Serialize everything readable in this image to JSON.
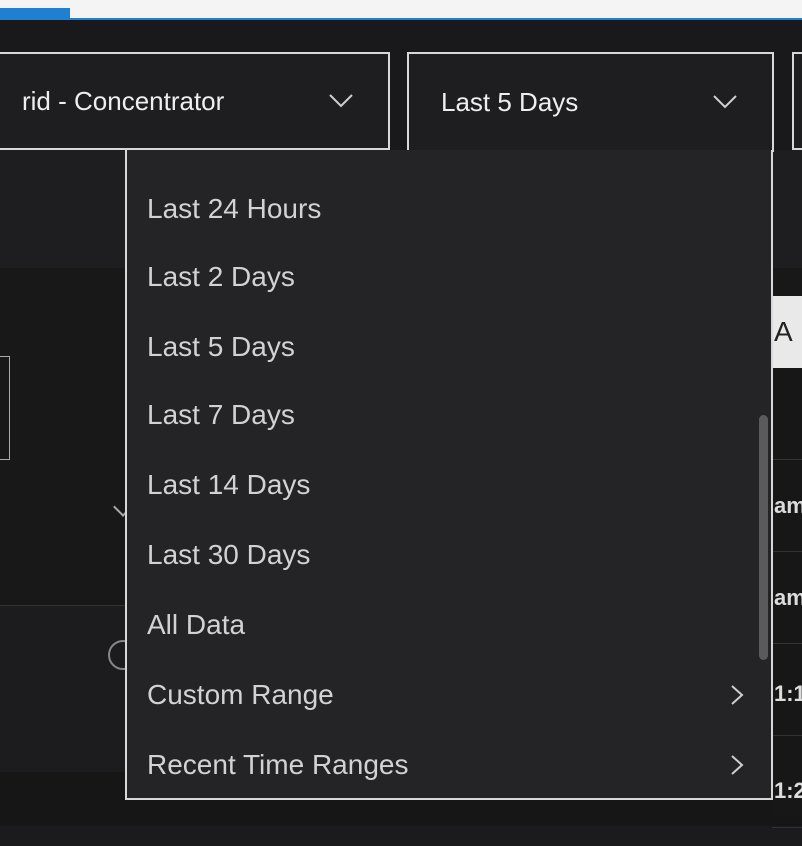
{
  "filters": {
    "service": {
      "value": "rid - Concentrator",
      "icon": "chevron-down-icon"
    },
    "time_range": {
      "value": "Last 5 Days",
      "icon": "chevron-down-icon"
    }
  },
  "time_menu": {
    "items": [
      {
        "label": "Last 24 Hours"
      },
      {
        "label": "Last 2 Days"
      },
      {
        "label": "Last 5 Days"
      },
      {
        "label": "Last 7 Days"
      },
      {
        "label": "Last 14 Days"
      },
      {
        "label": "Last 30 Days"
      },
      {
        "label": "All Data"
      },
      {
        "label": "Custom Range",
        "icon": "chevron-right-icon"
      },
      {
        "label": "Recent Time Ranges",
        "icon": "chevron-right-icon"
      }
    ]
  },
  "background_table": {
    "header_fragment": "A",
    "row_fragments": [
      "",
      "am",
      "am",
      "1:1",
      "1:2"
    ]
  },
  "colors": {
    "accent": "#1f7fd1",
    "background": "#19191b",
    "menu_bg": "#242426",
    "text": "#d2d2d2"
  }
}
